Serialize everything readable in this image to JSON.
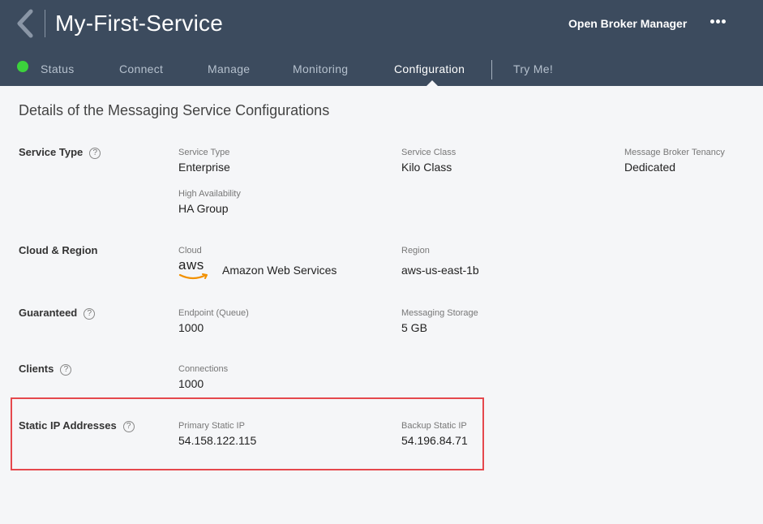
{
  "header": {
    "title": "My-First-Service",
    "open_broker_manager": "Open Broker Manager",
    "more_label": "•••"
  },
  "tabs": [
    {
      "label": "Status",
      "status_color": "#3cd23c"
    },
    {
      "label": "Connect"
    },
    {
      "label": "Manage"
    },
    {
      "label": "Monitoring"
    },
    {
      "label": "Configuration",
      "active": true
    },
    {
      "label": "Try Me!"
    }
  ],
  "page": {
    "heading": "Details of the Messaging Service Configurations",
    "help_glyph": "?"
  },
  "sections": {
    "service_type": {
      "title": "Service Type",
      "fields": [
        {
          "label": "Service Type",
          "value": "Enterprise"
        },
        {
          "label": "Service Class",
          "value": "Kilo Class"
        },
        {
          "label": "Message Broker Tenancy",
          "value": "Dedicated"
        },
        {
          "label": "High Availability",
          "value": "HA Group"
        }
      ]
    },
    "cloud_region": {
      "title": "Cloud & Region",
      "cloud_label": "Cloud",
      "cloud_logo_text": "aws",
      "cloud_value": "Amazon Web Services",
      "region_label": "Region",
      "region_value": "aws-us-east-1b"
    },
    "guaranteed": {
      "title": "Guaranteed",
      "fields": [
        {
          "label": "Endpoint (Queue)",
          "value": "1000"
        },
        {
          "label": "Messaging Storage",
          "value": "5 GB"
        }
      ]
    },
    "clients": {
      "title": "Clients",
      "fields": [
        {
          "label": "Connections",
          "value": "1000"
        }
      ]
    },
    "static_ip": {
      "title": "Static IP Addresses",
      "fields": [
        {
          "label": "Primary Static IP",
          "value": "54.158.122.115"
        },
        {
          "label": "Backup Static IP",
          "value": "54.196.84.71"
        }
      ]
    }
  },
  "colors": {
    "header_bg": "#3c4b5e",
    "highlight_border": "#e5484d",
    "aws_orange": "#f29100"
  }
}
